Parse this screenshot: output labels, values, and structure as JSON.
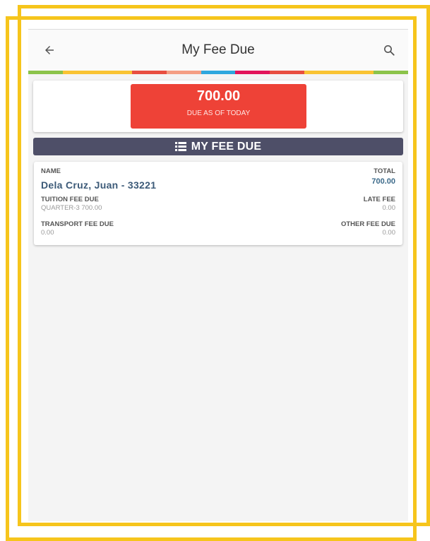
{
  "header": {
    "title": "My Fee Due",
    "back_icon": "arrow-left-icon",
    "search_icon": "search-icon"
  },
  "stripe_colors": [
    "#8bc34a",
    "#f9c333",
    "#f9c333",
    "#e84e40",
    "#f49e84",
    "#2ea7de",
    "#e2145b",
    "#e84e40",
    "#f9c333",
    "#f9c333",
    "#8bc34a"
  ],
  "summary": {
    "amount": "700.00",
    "caption": "DUE AS OF TODAY",
    "accent": "#ee4237"
  },
  "section": {
    "title": "MY FEE DUE",
    "icon": "list-icon",
    "color": "#4e4f68"
  },
  "fee_card": {
    "name_label": "NAME",
    "name_value": "Dela Cruz, Juan - 33221",
    "total_label": "TOTAL",
    "total_value": "700.00",
    "tuition_label": "TUITION FEE DUE",
    "tuition_value": "QUARTER-3 700.00",
    "late_label": "LATE FEE",
    "late_value": "0.00",
    "transport_label": "TRANSPORT FEE DUE",
    "transport_value": "0.00",
    "other_label": "OTHER FEE DUE",
    "other_value": "0.00"
  },
  "frame_color": "#f6c51c"
}
